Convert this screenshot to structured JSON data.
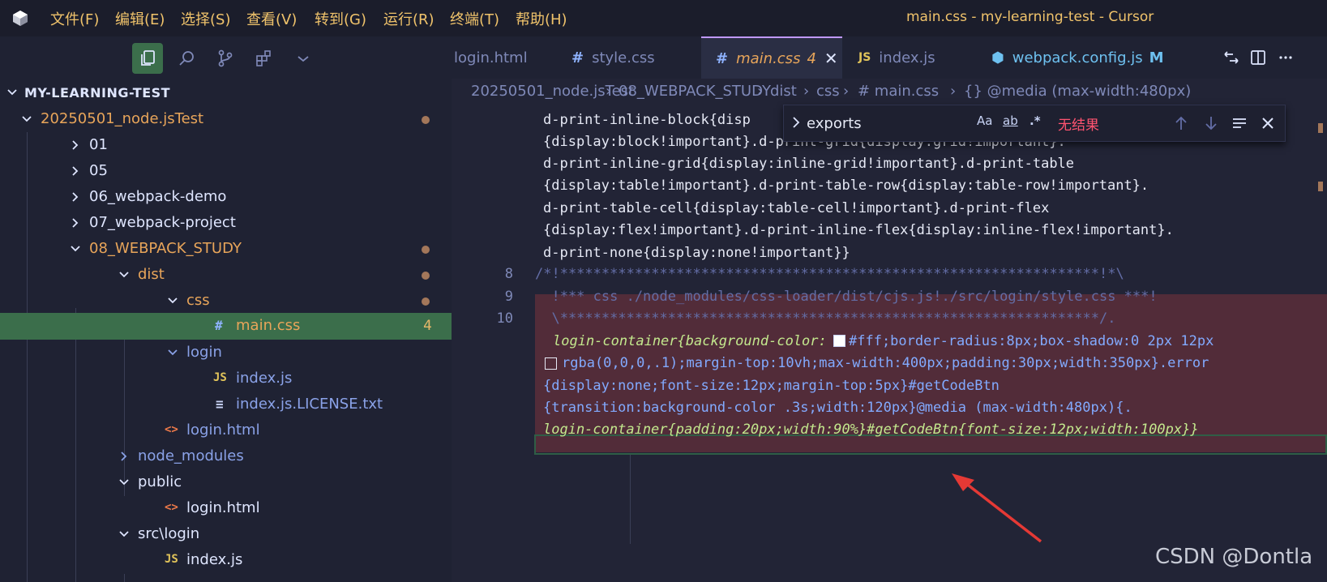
{
  "window": {
    "title": "main.css - my-learning-test - Cursor"
  },
  "menu": [
    "文件(F)",
    "编辑(E)",
    "选择(S)",
    "查看(V)",
    "转到(G)",
    "运行(R)",
    "终端(T)",
    "帮助(H)"
  ],
  "sidebar": {
    "title": "MY-LEARNING-TEST",
    "tree": [
      {
        "label": "20250501_node.jsTest",
        "kind": "folder-open",
        "color": "#e8a55a",
        "dot": true
      },
      {
        "label": "01",
        "kind": "folder-closed",
        "color": "#dfe6ff"
      },
      {
        "label": "05",
        "kind": "folder-closed",
        "color": "#dfe6ff"
      },
      {
        "label": "06_webpack-demo",
        "kind": "folder-closed",
        "color": "#dfe6ff"
      },
      {
        "label": "07_webpack-project",
        "kind": "folder-closed",
        "color": "#dfe6ff"
      },
      {
        "label": "08_WEBPACK_STUDY",
        "kind": "folder-open",
        "color": "#e8a55a",
        "dot": true
      },
      {
        "label": "dist",
        "kind": "folder-open",
        "color": "#e8a55a",
        "dot": true
      },
      {
        "label": "css",
        "kind": "folder-open",
        "color": "#e8a55a",
        "dot": true
      },
      {
        "label": "main.css",
        "kind": "file-css",
        "icon": "#",
        "color": "#e8a55a",
        "count": "4"
      },
      {
        "label": "login",
        "kind": "folder-open",
        "color": "#8aa2e8"
      },
      {
        "label": "index.js",
        "kind": "file-js",
        "icon": "JS",
        "color": "#8aa2e8"
      },
      {
        "label": "index.js.LICENSE.txt",
        "kind": "file-txt",
        "icon": "≡",
        "color": "#8aa2e8"
      },
      {
        "label": "login.html",
        "kind": "file-html",
        "icon": "<>",
        "color": "#8aa2e8"
      },
      {
        "label": "node_modules",
        "kind": "folder-closed",
        "color": "#8aa2e8"
      },
      {
        "label": "public",
        "kind": "folder-open",
        "color": "#dfe6ff"
      },
      {
        "label": "login.html",
        "kind": "file-html",
        "icon": "<>",
        "color": "#dfe6ff"
      },
      {
        "label": "src\\login",
        "kind": "folder-open",
        "color": "#dfe6ff"
      },
      {
        "label": "index.js",
        "kind": "file-js",
        "icon": "JS",
        "color": "#dfe6ff"
      }
    ]
  },
  "tabs": [
    {
      "label": "login.html",
      "icon": "",
      "active": false
    },
    {
      "label": "style.css",
      "icon": "#",
      "active": false
    },
    {
      "label": "main.css",
      "icon": "#",
      "badge": "4",
      "active": true
    },
    {
      "label": "index.js",
      "icon": "JS",
      "active": false
    },
    {
      "label": "webpack.config.js",
      "icon": "⬢",
      "badge": "M",
      "active": false
    }
  ],
  "breadcrumb": [
    "20250501_node.jsTest",
    "08_WEBPACK_STUDY",
    "dist",
    "css",
    "# main.css",
    "{} @media (max-width:480px)"
  ],
  "find": {
    "value": "exports",
    "options": [
      "Aa",
      "ab",
      ".*"
    ],
    "result": "无结果"
  },
  "code": {
    "line_numbers": [
      "8",
      "9",
      "10"
    ],
    "wrapped_top": [
      "d-print-inline-block{disp",
      "{display:block!important}.d-print-grid{display:grid!important}.",
      "d-print-inline-grid{display:inline-grid!important}.d-print-table",
      "{display:table!important}.d-print-table-row{display:table-row!important}.",
      "d-print-table-cell{display:table-cell!important}.d-print-flex",
      "{display:flex!important}.d-print-inline-flex{display:inline-flex!important}.",
      "d-print-none{display:none!important}}"
    ],
    "comment_lines": [
      "/*!*****************************************************************!*\\",
      "  !*** css ./node_modules/css-loader/dist/cjs.js!./src/login/style.css ***!",
      "  \\*****************************************************************/."
    ],
    "login_lines": [
      "login-container{background-color:",
      "#fff;border-radius:8px;box-shadow:0 2px 12px",
      "rgba(0,0,0,.1);margin-top:10vh;max-width:400px;padding:30px;width:350px}.error",
      "{display:none;font-size:12px;margin-top:5px}#getCodeBtn",
      "{transition:background-color .3s;width:120px}@media (max-width:480px){.",
      "login-container{padding:20px;width:90%}#getCodeBtn{font-size:12px;width:100px}}"
    ]
  },
  "watermark": "CSDN @Dontla",
  "colors": {
    "accent": "#c099ff",
    "active_green": "#3b6e4b",
    "find_error": "#ff5370",
    "arrow": "#e53935"
  }
}
